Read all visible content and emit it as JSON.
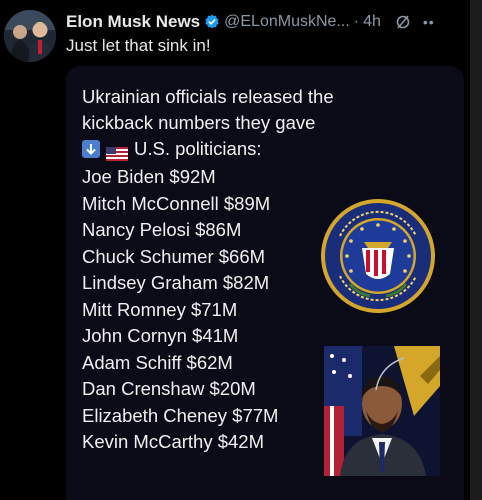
{
  "tweet": {
    "display_name": "Elon Musk News",
    "handle": "@ELonMuskNe...",
    "separator": "·",
    "time": "4h",
    "text": "Just let that sink in!"
  },
  "media": {
    "heading_line1": "Ukrainian officials released the",
    "heading_line2": "kickback numbers they gave",
    "subheading": "U.S. politicians:",
    "politicians": [
      "Joe Biden $92M",
      "Mitch McConnell $89M",
      "Nancy Pelosi $86M",
      "Chuck Schumer $66M",
      "Lindsey Graham $82M",
      "Mitt Romney $71M",
      "John Cornyn $41M",
      "Adam Schiff $62M",
      "Dan Crenshaw $20M",
      "Elizabeth Cheney $77M",
      "Kevin McCarthy $42M"
    ]
  },
  "icons": {
    "verified": "verified-badge-icon",
    "grok": "grok-icon",
    "more": "more-icon",
    "down_arrow": "down-arrow-emoji",
    "flag": "us-flag-emoji",
    "seal": "fbi-seal",
    "photo": "official-portrait"
  },
  "colors": {
    "background": "#000000",
    "media_background": "#0b0b18",
    "verified_blue": "#1d9bf0",
    "secondary_text": "#8b98a5",
    "primary_text": "#e7e9ea"
  }
}
